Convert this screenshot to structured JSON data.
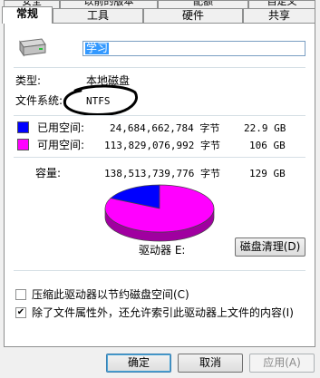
{
  "tabs": {
    "back_row": [
      "安全",
      "以前的版本",
      "配额",
      "自定义"
    ],
    "front_row": [
      "常规",
      "工具",
      "硬件",
      "共享"
    ]
  },
  "general": {
    "drive_name_value": "学习",
    "type_label": "类型:",
    "type_value": "本地磁盘",
    "fs_label": "文件系统:",
    "fs_value": "NTFS",
    "used_label": "已用空间:",
    "used_bytes": "24,684,662,784 字节",
    "used_size": "22.9 GB",
    "free_label": "可用空间:",
    "free_bytes": "113,829,076,992 字节",
    "free_size": "106 GB",
    "capacity_label": "容量:",
    "capacity_bytes": "138,513,739,776 字节",
    "capacity_size": "129 GB",
    "drive_caption": "驱动器 E:",
    "cleanup_button": "磁盘清理(D)",
    "compress_label": "压缩此驱动器以节约磁盘空间(C)",
    "compress_checked": false,
    "index_label": "除了文件属性外，还允许索引此驱动器上文件的内容(I)",
    "index_checked": true
  },
  "colors": {
    "used": "#0000ff",
    "free": "#ff00ff"
  },
  "chart_data": {
    "type": "pie",
    "categories": [
      "已用空间",
      "可用空间"
    ],
    "values": [
      24684662784,
      113829076992
    ]
  },
  "footer": {
    "ok": "确定",
    "cancel": "取消",
    "apply": "应用(A)"
  }
}
